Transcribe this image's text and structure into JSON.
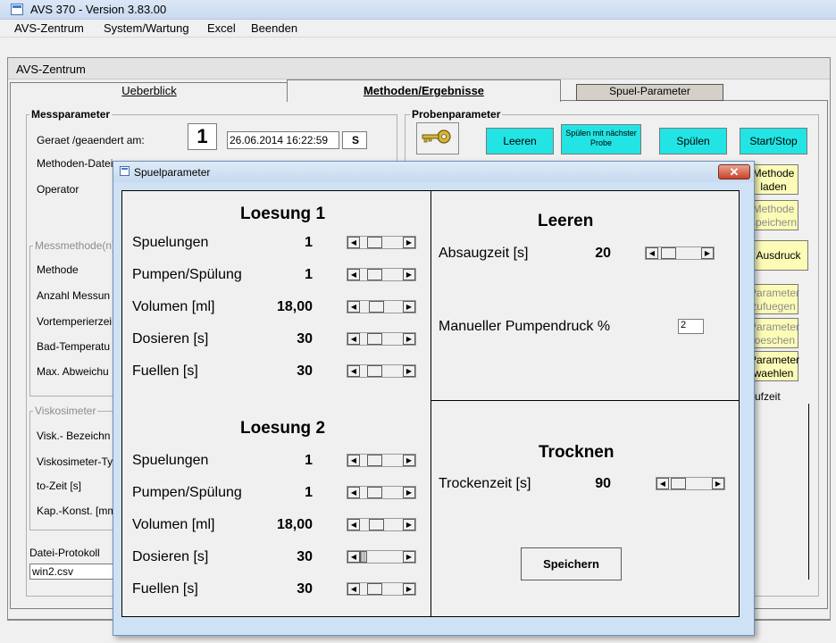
{
  "window": {
    "title": "AVS 370 - Version 3.83.00"
  },
  "menu": [
    "AVS-Zentrum",
    "System/Wartung",
    "Excel",
    "Beenden"
  ],
  "frame_title": "AVS-Zentrum",
  "tabs": {
    "ueberblick": "Ueberblick",
    "methoden": "Methoden/Ergebnisse",
    "spuel": "Spuel-Parameter"
  },
  "messparameter": {
    "title": "Messparameter",
    "geraet_label": "Geraet /geaendert am:",
    "geraet_value": "1",
    "date_value": "26.06.2014 16:22:59",
    "s_value": "S",
    "methoden_label": "Methoden-Datei",
    "operator_label": "Operator",
    "messmethode_title": "Messmethode(n)",
    "methode_label": "Methode",
    "anzahl_label": "Anzahl Messun",
    "vortemp_label": "Vortemperierzei",
    "bad_label": "Bad-Temperatu",
    "max_label": "Max. Abweichu",
    "visko_title": "Viskosimeter",
    "visk_bez_label": "Visk.- Bezeichn",
    "visk_typ_label": "Viskosimeter-Ty",
    "to_zeit_label": "to-Zeit [s]",
    "kap_label": "Kap.-Konst. [mm",
    "protokoll_label": "Datei-Protokoll",
    "protokoll_value": "win2.csv"
  },
  "probenparameter": {
    "title": "Probenparameter",
    "leeren_button": "Leeren",
    "spuelen_naechste_button": "Spülen mit nächster Probe",
    "spuelen_button": "Spülen",
    "startstop_button": "Start/Stop",
    "methode_laden_button": "Methode laden",
    "methode_speichern_button": "Methode speichern",
    "ausdruck_button": "Ausdruck",
    "parameter_zufuegen_button": "Parameter zufuegen",
    "parameter_loeschen_button": "Parameter loeschen",
    "parameter_waehlen_button": "Parameter waehlen",
    "laufzeit_label": "ufzeit"
  },
  "dialog": {
    "title": "Spuelparameter",
    "close_label": "✕",
    "loesung1": {
      "heading": "Loesung 1",
      "rows": [
        {
          "label": "Spuelungen",
          "value": "1",
          "level": 0.25
        },
        {
          "label": "Pumpen/Spülung",
          "value": "1",
          "level": 0.25
        },
        {
          "label": "Volumen [ml]",
          "value": "18,00",
          "level": 0.3
        },
        {
          "label": "Dosieren [s]",
          "value": "30",
          "level": 0.25
        },
        {
          "label": "Fuellen [s]",
          "value": "30",
          "level": 0.25
        }
      ]
    },
    "loesung2": {
      "heading": "Loesung 2",
      "rows": [
        {
          "label": "Spuelungen",
          "value": "1",
          "level": 0.25
        },
        {
          "label": "Pumpen/Spülung",
          "value": "1",
          "level": 0.25
        },
        {
          "label": "Volumen [ml]",
          "value": "18,00",
          "level": 0.3
        },
        {
          "label": "Dosieren [s]",
          "value": "30",
          "level": 0.0
        },
        {
          "label": "Fuellen [s]",
          "value": "30",
          "level": 0.25
        }
      ]
    },
    "leeren": {
      "heading": "Leeren",
      "absaugzeit_label": "Absaugzeit [s]",
      "absaugzeit_value": "20",
      "pumpendruck_label": "Manueller Pumpendruck %",
      "pumpendruck_value": "2"
    },
    "trocknen": {
      "heading": "Trocknen",
      "trockenzeit_label": "Trockenzeit [s]",
      "trockenzeit_value": "90"
    },
    "speichern_button": "Speichern"
  }
}
